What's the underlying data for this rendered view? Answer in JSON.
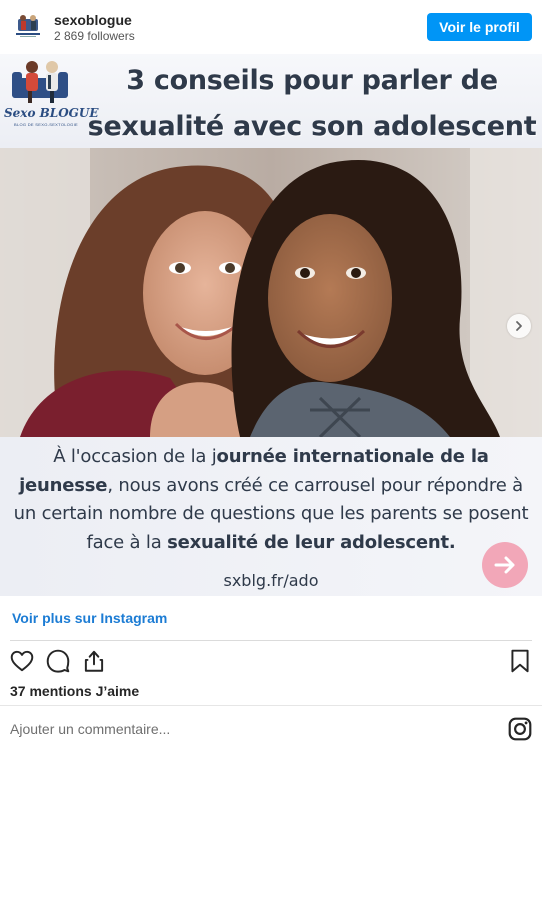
{
  "account": {
    "username": "sexoblogue",
    "followers": "2 869 followers",
    "view_profile_label": "Voir le profil"
  },
  "post": {
    "brand_name": "Sexo BLOGUE",
    "brand_tagline": "BLOG DE SEXO-SEXTOLOGIE",
    "headline_line1": "3 conseils pour parler de",
    "headline_line2": "sexualité avec son adolescent",
    "caption_parts": [
      "À l'occasion de la j",
      "ournée internationale de la jeunesse",
      ", nous avons créé ce carrousel pour répondre à un certain nombre de questions que les parents se posent face à la ",
      "sexualité de leur adolescent."
    ],
    "url": "sxblg.fr/ado"
  },
  "footer": {
    "more_link": "Voir plus sur Instagram",
    "likes": "37 mentions J’aime",
    "comment_placeholder": "Ajouter un commentaire..."
  },
  "colors": {
    "primary_button": "#0095f6",
    "link": "#1c7cd4",
    "arrow_accent": "#f2a7b8"
  },
  "icons": [
    "heart-icon",
    "comment-icon",
    "share-icon",
    "bookmark-icon",
    "instagram-icon",
    "chevron-right-icon",
    "arrow-right-icon"
  ]
}
